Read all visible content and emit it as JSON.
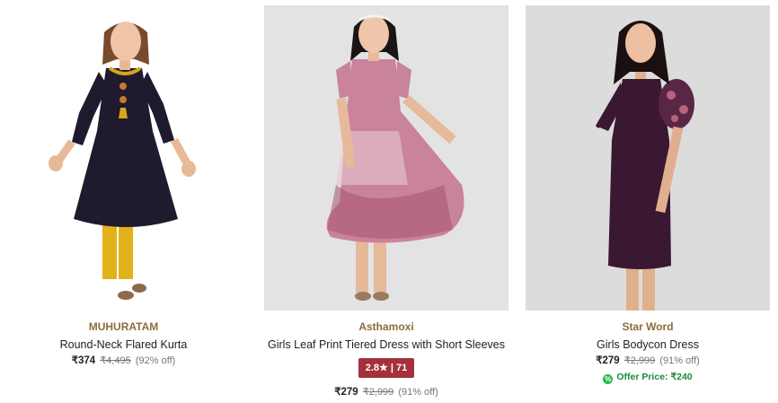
{
  "products": [
    {
      "brand": "MUHURATAM",
      "name": "Round-Neck Flared Kurta",
      "price": "₹374",
      "mrp": "₹4,495",
      "discount": "(92% off)"
    },
    {
      "brand": "Asthamoxi",
      "name": "Girls Leaf Print Tiered Dress with Short Sleeves",
      "rating": "2.8★ | 71",
      "price": "₹279",
      "mrp": "₹2,999",
      "discount": "(91% off)"
    },
    {
      "brand": "Star Word",
      "name": "Girls Bodycon Dress",
      "price": "₹279",
      "mrp": "₹2,999",
      "discount": "(91% off)",
      "offer_icon": "%",
      "offer": "Offer Price: ₹240"
    }
  ],
  "colors": {
    "brand_text": "#8a6d3b",
    "rating_badge": "#a3313a",
    "offer_text": "#1b8a3a"
  }
}
